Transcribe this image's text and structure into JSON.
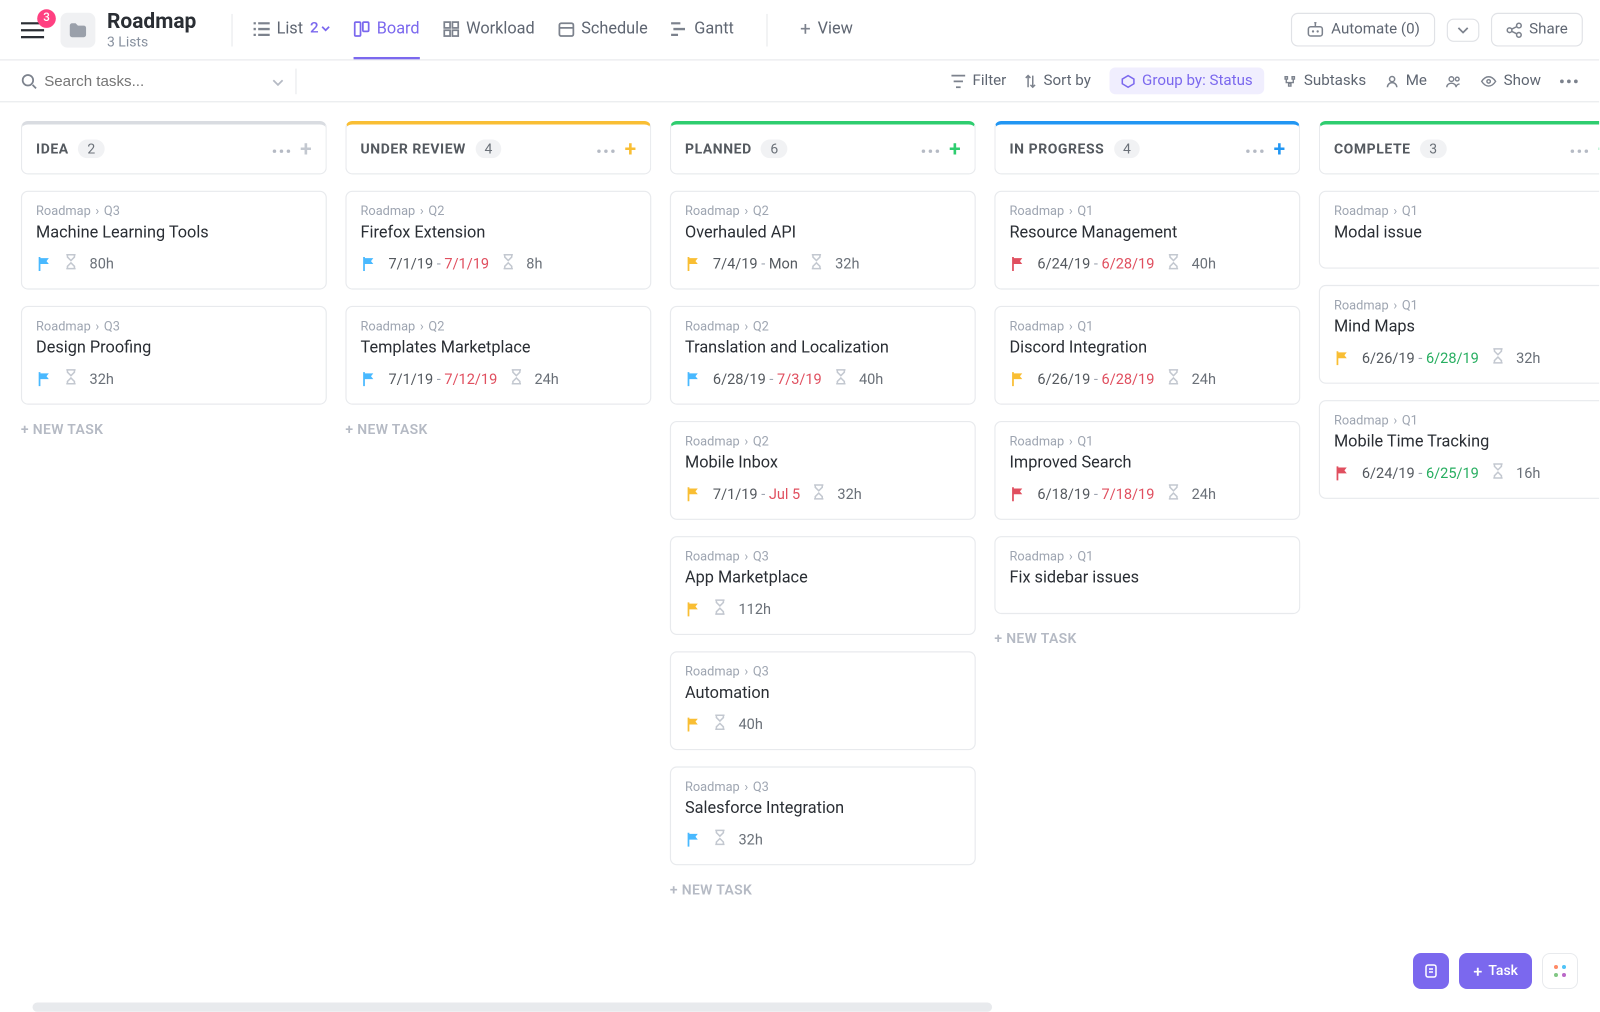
{
  "notifications_badge": "3",
  "header": {
    "title": "Roadmap",
    "subtitle": "3 Lists",
    "views": {
      "list": "List",
      "list_count": "2",
      "board": "Board",
      "workload": "Workload",
      "schedule": "Schedule",
      "gantt": "Gantt",
      "add_view": "View"
    },
    "automate": "Automate (0)",
    "share": "Share"
  },
  "toolbar": {
    "search_placeholder": "Search tasks...",
    "filter": "Filter",
    "sort": "Sort by",
    "group": "Group by: Status",
    "subtasks": "Subtasks",
    "me": "Me",
    "show": "Show"
  },
  "new_task_label": "+ NEW TASK",
  "fab_task": "Task",
  "columns": [
    {
      "name": "IDEA",
      "count": "2",
      "accent": "#d9dce1",
      "plus_color": "#c3c8d0",
      "cards": [
        {
          "crumb1": "Roadmap",
          "crumb2": "Q3",
          "title": "Machine Learning Tools",
          "flag": "#49b9ff",
          "date1": "",
          "date2": "",
          "d2_class": "",
          "hours": "80h"
        },
        {
          "crumb1": "Roadmap",
          "crumb2": "Q3",
          "title": "Design Proofing",
          "flag": "#49b9ff",
          "date1": "",
          "date2": "",
          "d2_class": "",
          "hours": "32h"
        }
      ],
      "show_new": true
    },
    {
      "name": "UNDER REVIEW",
      "count": "4",
      "accent": "#f9be33",
      "plus_color": "#f9be33",
      "cards": [
        {
          "crumb1": "Roadmap",
          "crumb2": "Q2",
          "title": "Firefox Extension",
          "flag": "#49b9ff",
          "date1": "7/1/19",
          "date2": "7/1/19",
          "d2_class": "date-red",
          "hours": "8h"
        },
        {
          "crumb1": "Roadmap",
          "crumb2": "Q2",
          "title": "Templates Marketplace",
          "flag": "#49b9ff",
          "date1": "7/1/19",
          "date2": "7/12/19",
          "d2_class": "date-red",
          "hours": "24h"
        }
      ],
      "show_new": true
    },
    {
      "name": "PLANNED",
      "count": "6",
      "accent": "#2ecd6f",
      "plus_color": "#2ecd6f",
      "cards": [
        {
          "crumb1": "Roadmap",
          "crumb2": "Q2",
          "title": "Overhauled API",
          "flag": "#f9be33",
          "date1": "7/4/19",
          "date2": "Mon",
          "d2_class": "date-norm",
          "hours": "32h"
        },
        {
          "crumb1": "Roadmap",
          "crumb2": "Q2",
          "title": "Translation and Localization",
          "flag": "#49b9ff",
          "date1": "6/28/19",
          "date2": "7/3/19",
          "d2_class": "date-red",
          "hours": "40h"
        },
        {
          "crumb1": "Roadmap",
          "crumb2": "Q2",
          "title": "Mobile Inbox",
          "flag": "#f9be33",
          "date1": "7/1/19",
          "date2": "Jul 5",
          "d2_class": "date-red",
          "hours": "32h"
        },
        {
          "crumb1": "Roadmap",
          "crumb2": "Q3",
          "title": "App Marketplace",
          "flag": "#f9be33",
          "date1": "",
          "date2": "",
          "d2_class": "",
          "hours": "112h"
        },
        {
          "crumb1": "Roadmap",
          "crumb2": "Q3",
          "title": "Automation",
          "flag": "#f9be33",
          "date1": "",
          "date2": "",
          "d2_class": "",
          "hours": "40h"
        },
        {
          "crumb1": "Roadmap",
          "crumb2": "Q3",
          "title": "Salesforce Integration",
          "flag": "#49b9ff",
          "date1": "",
          "date2": "",
          "d2_class": "",
          "hours": "32h"
        }
      ],
      "show_new": true
    },
    {
      "name": "IN PROGRESS",
      "count": "4",
      "accent": "#2196f3",
      "plus_color": "#2196f3",
      "cards": [
        {
          "crumb1": "Roadmap",
          "crumb2": "Q1",
          "title": "Resource Management",
          "flag": "#e04f5f",
          "date1": "6/24/19",
          "date2": "6/28/19",
          "d2_class": "date-red",
          "hours": "40h"
        },
        {
          "crumb1": "Roadmap",
          "crumb2": "Q1",
          "title": "Discord Integration",
          "flag": "#f9be33",
          "date1": "6/26/19",
          "date2": "6/28/19",
          "d2_class": "date-red",
          "hours": "24h"
        },
        {
          "crumb1": "Roadmap",
          "crumb2": "Q1",
          "title": "Improved Search",
          "flag": "#e04f5f",
          "date1": "6/18/19",
          "date2": "7/18/19",
          "d2_class": "date-red",
          "hours": "24h"
        },
        {
          "crumb1": "Roadmap",
          "crumb2": "Q1",
          "title": "Fix sidebar issues",
          "flag": "",
          "date1": "",
          "date2": "",
          "d2_class": "",
          "hours": ""
        }
      ],
      "show_new": true
    },
    {
      "name": "COMPLETE",
      "count": "3",
      "accent": "#2ecd6f",
      "plus_color": "#2ecd6f",
      "cards": [
        {
          "crumb1": "Roadmap",
          "crumb2": "Q1",
          "title": "Modal issue",
          "flag": "",
          "date1": "",
          "date2": "",
          "d2_class": "",
          "hours": ""
        },
        {
          "crumb1": "Roadmap",
          "crumb2": "Q1",
          "title": "Mind Maps",
          "flag": "#f9be33",
          "date1": "6/26/19",
          "date2": "6/28/19",
          "d2_class": "date-green",
          "hours": "32h"
        },
        {
          "crumb1": "Roadmap",
          "crumb2": "Q1",
          "title": "Mobile Time Tracking",
          "flag": "#e04f5f",
          "date1": "6/24/19",
          "date2": "6/25/19",
          "d2_class": "date-green",
          "hours": "16h"
        }
      ],
      "show_new": false
    }
  ]
}
